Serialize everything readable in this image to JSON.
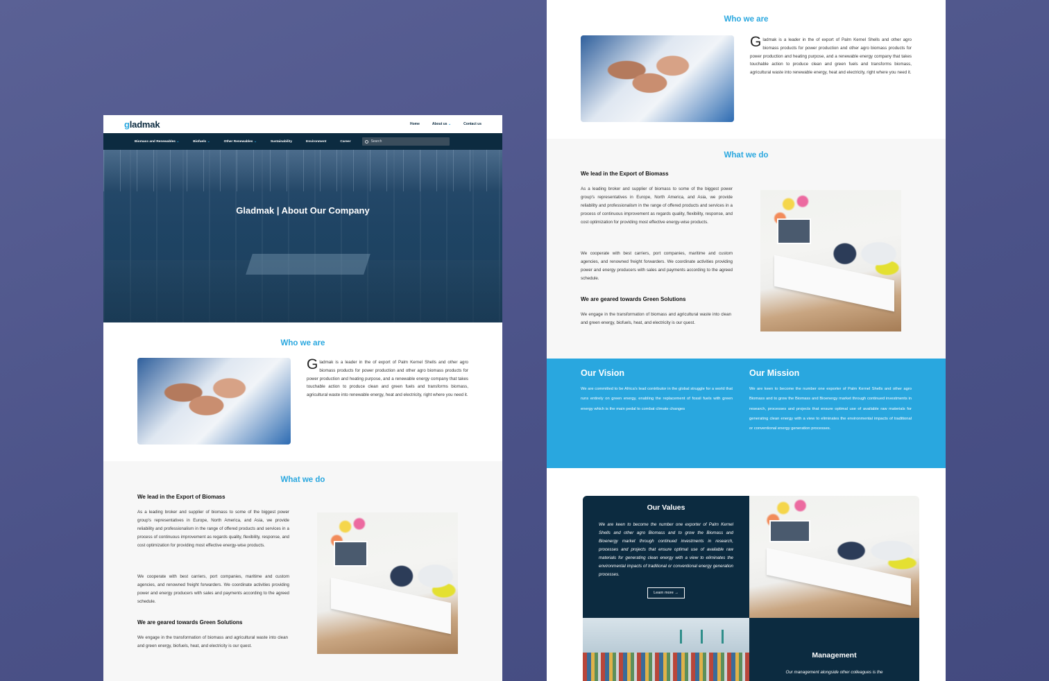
{
  "brand": {
    "logo_g": "g",
    "logo_rest": "ladmak"
  },
  "top_nav": [
    "Home",
    "About us",
    "Contact us"
  ],
  "main_nav": [
    "Biomass and Renewables",
    "Biofuels",
    "Other Renewables",
    "Sustainability",
    "Environment",
    "Career"
  ],
  "search": {
    "placeholder": "Search"
  },
  "hero": {
    "title": "Gladmak | About Our Company"
  },
  "who": {
    "heading": "Who we are",
    "dropcap": "G",
    "text": "ladmak is a leader in the of export of Palm Kernel Shells and other agro biomass products for power production and other agro biomass products for power production and heating purpose, and a renewable energy company that takes touchable action to produce clean and green fuels and transforms biomass, agricultural waste into renewable energy, heat and electricity, right where you need it."
  },
  "what": {
    "heading": "What we do",
    "sub1": "We lead in the Export of Biomass",
    "p1": "As a leading broker and supplier of biomass to some of the biggest power group's representatives in Europe, North America, and Asia, we provide reliability and professionalism in the range of offered products and services in a process of continuous improvement as regards quality, flexibility, response, and cost optimization for providing most effective energy-wise products.",
    "p2": "We cooperate with best carriers, port companies, maritime and custom agencies, and renowned freight forwarders. We coordinate activities providing power and energy producers with sales and payments according to the agreed schedule.",
    "sub2": "We are geared towards Green Solutions",
    "p3": "We engage in the transformation of biomass and agricultural waste into clean and green energy, biofuels, heat, and electricity is our quest."
  },
  "vision": {
    "heading": "Our Vision",
    "text": "We are committed to be Africa's lead contributor in the global struggle for a world that runs entirely on  green energy, enabling the replacement of fossil fuels with green energy which is the main pedal to combat  climate changes"
  },
  "mission": {
    "heading": "Our Mission",
    "text": "We are keen to become the number one exporter of Palm Kernel Shells and other agro Biomass and to  grow the Biomass and Bioenergy market through continued investments in research, processes and  projects that ensure optimal use of available raw materials for generating clean energy with a view to eliminates the environmental impacts of traditional or conventional energy generation processes."
  },
  "values": {
    "heading": "Our Values",
    "text": "We are keen to become the number one exporter of Palm Kernel Shells and other agro Biomass and to grow the Biomass and Bioenergy market through continued investments in research, processes and projects that ensure optimal use of available raw materials for generating clean energy with a view to eliminates the environmental impacts of traditional or conventional energy generation processes.",
    "button": "Learn more"
  },
  "management": {
    "heading": "Management",
    "text": "Our management alongside other colleagues is the"
  },
  "colors": {
    "accent": "#29a7df",
    "navy": "#0c2b40",
    "backdrop": "#545b91"
  }
}
